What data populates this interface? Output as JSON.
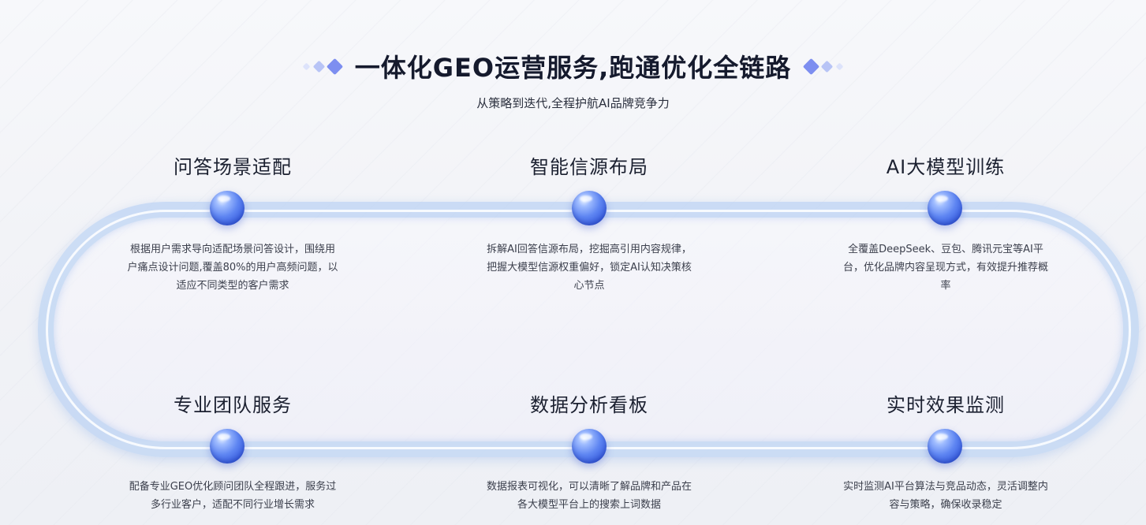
{
  "header": {
    "title": "一体化GEO运营服务,跑通优化全链路",
    "subtitle": "从策略到迭代,全程护航AI品牌竞争力"
  },
  "nodes": [
    {
      "title": "问答场景适配",
      "description": "根据用户需求导向适配场景问答设计，围绕用户痛点设计问题,覆盖80%的用户高频问题，以适应不同类型的客户需求"
    },
    {
      "title": "智能信源布局",
      "description": "拆解AI回答信源布局，挖掘高引用内容规律，把握大模型信源权重偏好，锁定AI认知决策核心节点"
    },
    {
      "title": "AI大模型训练",
      "description": "全覆盖DeepSeek、豆包、腾讯元宝等AI平台，优化品牌内容呈现方式，有效提升推荐概率"
    },
    {
      "title": "专业团队服务",
      "description": "配备专业GEO优化顾问团队全程跟进，服务过多行业客户，适配不同行业增长需求"
    },
    {
      "title": "数据分析看板",
      "description": "数据报表可视化，可以清晰了解品牌和产品在各大模型平台上的搜索上词数据"
    },
    {
      "title": "实时效果监测",
      "description": "实时监测AI平台算法与竞品动态，灵活调整内容与策略，确保收录稳定"
    }
  ],
  "colors": {
    "accent": "#5f86f2",
    "title": "#151a2d",
    "text": "#3b3f4c"
  }
}
